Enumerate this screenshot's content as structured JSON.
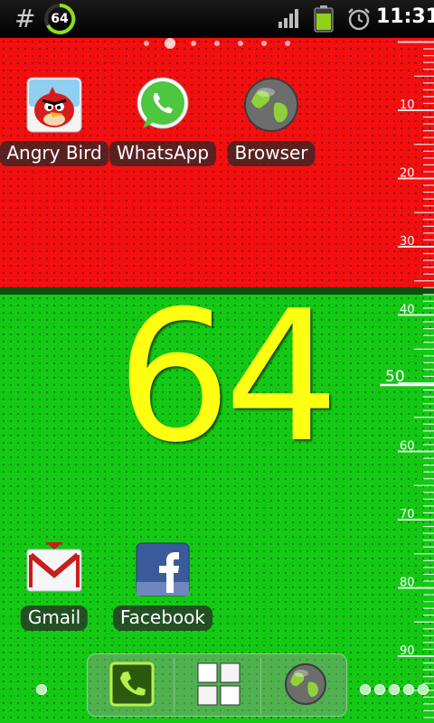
{
  "status_bar": {
    "left_icon": "hash-icon",
    "ring_value": "64",
    "icons": [
      "signal-icon",
      "battery-icon",
      "alarm-icon"
    ],
    "time": "11:31"
  },
  "home": {
    "page_count": 7,
    "active_page": 1,
    "apps_top": [
      {
        "label": "Angry Bird",
        "icon": "angry-bird-icon"
      },
      {
        "label": "WhatsApp",
        "icon": "whatsapp-icon"
      },
      {
        "label": "Browser",
        "icon": "browser-globe-icon"
      }
    ],
    "apps_bottom": [
      {
        "label": "Gmail",
        "icon": "gmail-icon"
      },
      {
        "label": "Facebook",
        "icon": "facebook-icon"
      }
    ]
  },
  "widget": {
    "big_value": "64",
    "ruler_labels": [
      "10",
      "20",
      "30",
      "40",
      "50",
      "60",
      "70",
      "80",
      "90"
    ],
    "ruler_major": "50",
    "colors": {
      "red": "#f20f0f",
      "green": "#14c914",
      "number": "#ffff11"
    }
  },
  "dock": {
    "items": [
      "phone-icon",
      "app-drawer-icon",
      "browser-globe-icon"
    ]
  }
}
